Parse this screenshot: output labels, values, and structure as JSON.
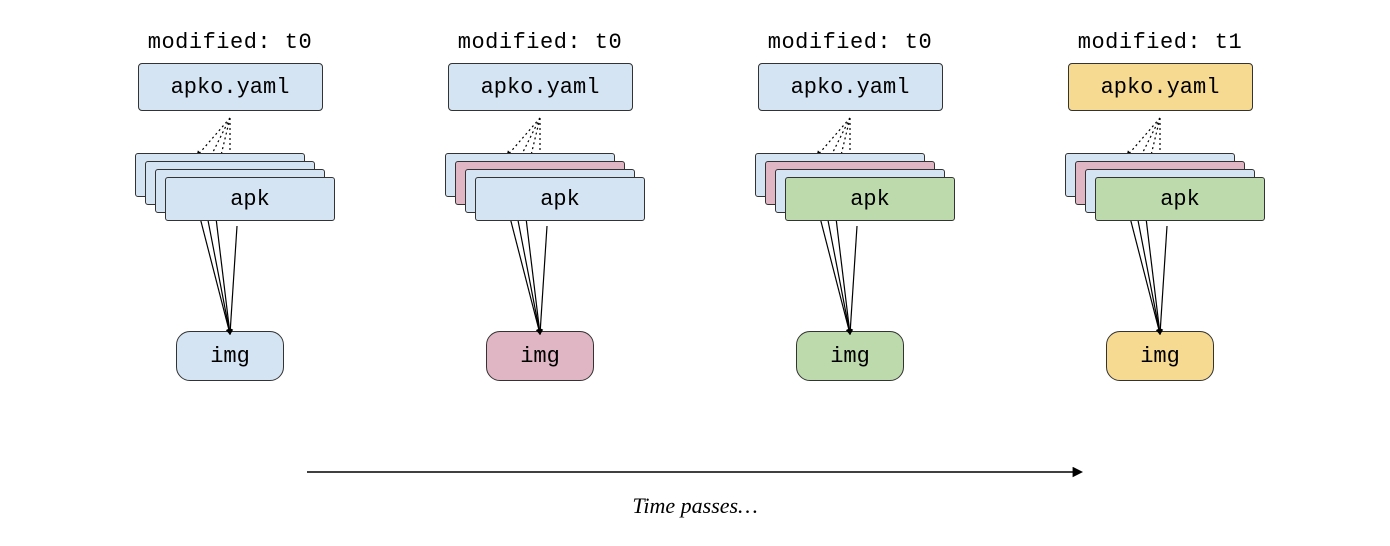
{
  "diagram": {
    "columns": [
      {
        "modified": "modified: t0",
        "yaml": {
          "label": "apko.yaml",
          "color": "c-blue"
        },
        "apk": {
          "label": "apk",
          "front_color": "c-blue",
          "layers": [
            "c-blue",
            "c-blue",
            "c-blue"
          ]
        },
        "img": {
          "label": "img",
          "color": "c-blue"
        }
      },
      {
        "modified": "modified: t0",
        "yaml": {
          "label": "apko.yaml",
          "color": "c-blue"
        },
        "apk": {
          "label": "apk",
          "front_color": "c-blue",
          "layers": [
            "c-blue",
            "c-pink",
            "c-blue"
          ]
        },
        "img": {
          "label": "img",
          "color": "c-pink"
        }
      },
      {
        "modified": "modified: t0",
        "yaml": {
          "label": "apko.yaml",
          "color": "c-blue"
        },
        "apk": {
          "label": "apk",
          "front_color": "c-green",
          "layers": [
            "c-blue",
            "c-pink",
            "c-blue"
          ]
        },
        "img": {
          "label": "img",
          "color": "c-green"
        }
      },
      {
        "modified": "modified: t1",
        "yaml": {
          "label": "apko.yaml",
          "color": "c-yellow"
        },
        "apk": {
          "label": "apk",
          "front_color": "c-green",
          "layers": [
            "c-blue",
            "c-pink",
            "c-blue"
          ]
        },
        "img": {
          "label": "img",
          "color": "c-yellow"
        }
      }
    ],
    "timeline_label": "Time passes…"
  }
}
